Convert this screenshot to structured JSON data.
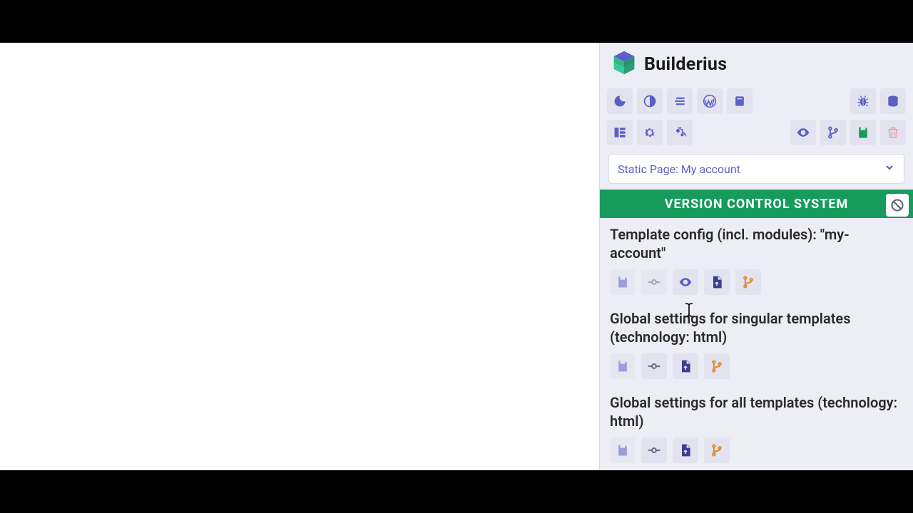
{
  "brand": {
    "name": "Builderius"
  },
  "page_select": {
    "label": "Static Page: My account"
  },
  "vcs": {
    "header": "VERSION CONTROL SYSTEM",
    "sections": [
      {
        "title": "Template config (incl. modules): \"my-account\""
      },
      {
        "title": "Global settings for singular templates (technology: html)"
      },
      {
        "title": "Global settings for all templates (technology: html)"
      }
    ]
  }
}
